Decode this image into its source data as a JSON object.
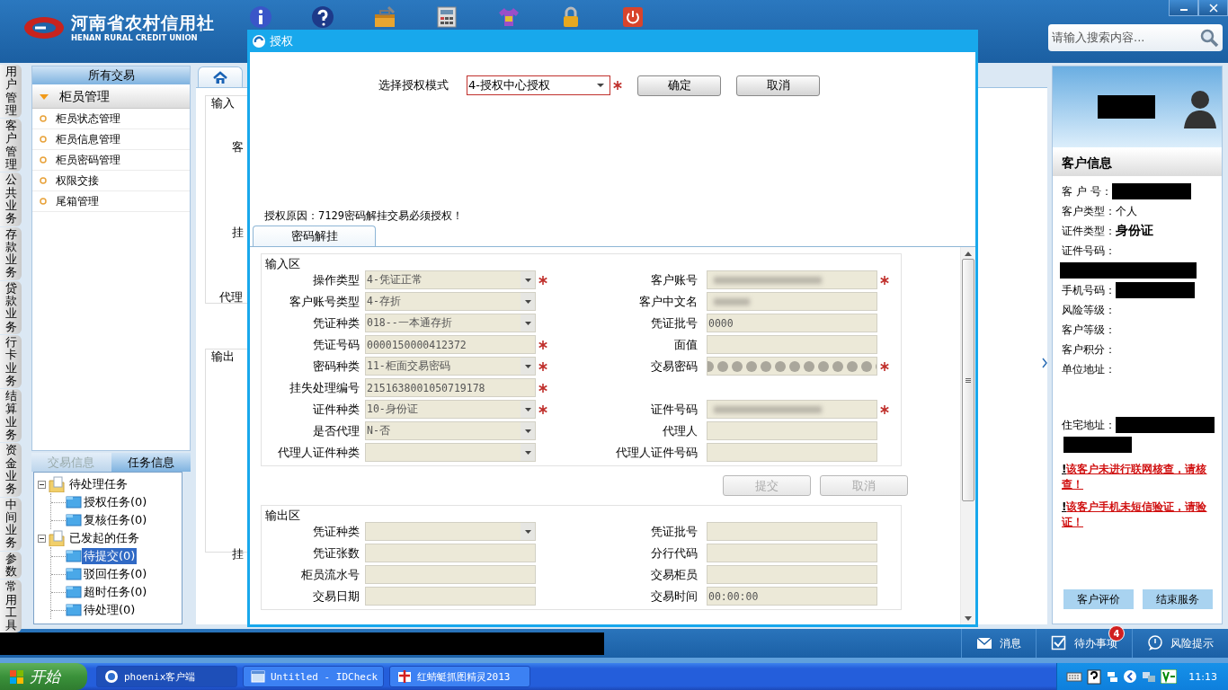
{
  "header": {
    "logo_title": "河南省农村信用社",
    "logo_subtitle": "HENAN RURAL CREDIT UNION",
    "toolbar": [
      {
        "kind": "info"
      },
      {
        "kind": "help"
      },
      {
        "kind": "toolbox"
      },
      {
        "kind": "calculator"
      },
      {
        "kind": "shirt"
      },
      {
        "kind": "lock"
      },
      {
        "kind": "power"
      }
    ],
    "search": {
      "placeholder": "请输入搜索内容..."
    }
  },
  "nav_rail": [
    "用户管理",
    "客户管理",
    "公共业务",
    "存款业务",
    "贷款业务",
    "行卡业务",
    "结算业务",
    "资金业务",
    "中间业务",
    "参数",
    "常用工具"
  ],
  "sidebar": {
    "title": "所有交易",
    "group": {
      "label": "柜员管理",
      "expanded": true,
      "items": [
        "柜员状态管理",
        "柜员信息管理",
        "柜员密码管理",
        "权限交接",
        "尾箱管理"
      ]
    },
    "tabs": [
      {
        "label": "交易信息",
        "selected": false
      },
      {
        "label": "任务信息",
        "selected": true
      }
    ],
    "tree": [
      {
        "label": "待处理任务",
        "expanded": true,
        "children": [
          {
            "label": "授权任务(0)",
            "selected": false
          },
          {
            "label": "复核任务(0)",
            "selected": false
          }
        ]
      },
      {
        "label": "已发起的任务",
        "expanded": true,
        "children": [
          {
            "label": "待提交(0)",
            "selected": true
          },
          {
            "label": "驳回任务(0)",
            "selected": false
          },
          {
            "label": "超时任务(0)",
            "selected": false
          },
          {
            "label": "待处理(0)",
            "selected": false
          }
        ]
      }
    ]
  },
  "workspace": {
    "labels": [
      {
        "kind": "section",
        "text": "输入"
      },
      {
        "kind": "field",
        "text": "客"
      },
      {
        "kind": "field",
        "text": "挂"
      },
      {
        "kind": "field",
        "text": "代理"
      },
      {
        "kind": "section",
        "text": "输出"
      },
      {
        "kind": "field",
        "text": "挂"
      }
    ]
  },
  "dialog": {
    "title": "授权",
    "mode": {
      "label": "选择授权模式",
      "value": "4-授权中心授权",
      "required": true
    },
    "buttons": [
      "确定",
      "取消"
    ],
    "reason": "授权原因：7129密码解挂交易必须授权！",
    "tab": {
      "label": "密码解挂",
      "selected": true
    },
    "input_area": {
      "title": "输入区",
      "rows": [
        {
          "left": {
            "label": "操作类型",
            "kind": "select",
            "value": "4-凭证正常",
            "required": true
          },
          "right": {
            "label": "客户账号",
            "kind": "blurred",
            "required": true
          }
        },
        {
          "left": {
            "label": "客户账号类型",
            "kind": "select",
            "value": "4-存折",
            "required": false
          },
          "right": {
            "label": "客户中文名",
            "kind": "blurred",
            "required": false
          }
        },
        {
          "left": {
            "label": "凭证种类",
            "kind": "select",
            "value": "018--一本通存折",
            "required": false
          },
          "right": {
            "label": "凭证批号",
            "kind": "text",
            "value": "0000",
            "required": false
          }
        },
        {
          "left": {
            "label": "凭证号码",
            "kind": "text",
            "value": "0000150000412372",
            "required": true
          },
          "right": {
            "label": "面值",
            "kind": "text",
            "required": false
          }
        },
        {
          "left": {
            "label": "密码种类",
            "kind": "select",
            "value": "11-柜面交易密码",
            "required": true
          },
          "right": {
            "label": "交易密码",
            "kind": "masked",
            "required": true
          }
        },
        {
          "left": {
            "label": "挂失处理编号",
            "kind": "text",
            "value": "2151638001050719178",
            "required": true
          }
        },
        {
          "left": {
            "label": "证件种类",
            "kind": "select",
            "value": "10-身份证",
            "required": true
          },
          "right": {
            "label": "证件号码",
            "kind": "blurred",
            "required": true
          }
        },
        {
          "left": {
            "label": "是否代理",
            "kind": "select",
            "value": "N-否",
            "required": false
          },
          "right": {
            "label": "代理人",
            "kind": "text",
            "required": false
          }
        },
        {
          "left": {
            "label": "代理人证件种类",
            "kind": "select",
            "required": false
          },
          "right": {
            "label": "代理人证件号码",
            "kind": "text",
            "required": false
          }
        }
      ]
    },
    "actions": [
      {
        "label": "提交",
        "disabled": true
      },
      {
        "label": "取消",
        "disabled": true
      }
    ],
    "output_area": {
      "title": "输出区",
      "rows": [
        {
          "left": {
            "label": "凭证种类",
            "kind": "select",
            "required": false
          },
          "right": {
            "label": "凭证批号",
            "kind": "text",
            "required": false
          }
        },
        {
          "left": {
            "label": "凭证张数",
            "kind": "text",
            "required": false
          },
          "right": {
            "label": "分行代码",
            "kind": "text",
            "required": false
          }
        },
        {
          "left": {
            "label": "柜员流水号",
            "kind": "text",
            "required": false
          },
          "right": {
            "label": "交易柜员",
            "kind": "text",
            "required": false
          }
        },
        {
          "left": {
            "label": "交易日期",
            "kind": "text",
            "required": false
          },
          "right": {
            "label": "交易时间",
            "kind": "text",
            "value": "00:00:00",
            "required": false
          }
        }
      ]
    }
  },
  "customer": {
    "title": "客户信息",
    "rows": [
      {
        "label": "客 户 号：",
        "kind": "redacted"
      },
      {
        "label": "客户类型：",
        "kind": "text",
        "value": "个人"
      },
      {
        "label": "证件类型：",
        "kind": "bold",
        "value": "身份证"
      },
      {
        "label": "证件号码：",
        "kind": "redacted_below"
      },
      {
        "label": "手机号码：",
        "kind": "redacted"
      },
      {
        "label": "风险等级：",
        "kind": "empty"
      },
      {
        "label": "客户等级：",
        "kind": "empty"
      },
      {
        "label": "客户积分：",
        "kind": "empty"
      },
      {
        "label": "单位地址：",
        "kind": "empty_tall"
      },
      {
        "label": "住宅地址：",
        "kind": "redacted_two"
      }
    ],
    "warnings": [
      {
        "mark": "!",
        "text": "该客户未进行联网核查，请核查！"
      },
      {
        "mark": "!",
        "text": "该客户手机未短信验证，请验证！"
      }
    ],
    "buttons": [
      "客户评价",
      "结束服务"
    ]
  },
  "status_bar": {
    "items": [
      {
        "kind": "mail",
        "label": "消息"
      },
      {
        "kind": "check",
        "label": "待办事项",
        "badge": "4"
      },
      {
        "kind": "bubble",
        "label": "风险提示"
      }
    ]
  },
  "taskbar": {
    "start": "开始",
    "tasks": [
      {
        "kind": "browser",
        "label": "phoenix客户端",
        "selected": true
      },
      {
        "kind": "window",
        "label": "Untitled - IDCheck",
        "selected": false
      },
      {
        "kind": "capture",
        "label": "红蜻蜓抓图精灵2013",
        "selected": false
      }
    ],
    "clock": "11:13"
  }
}
